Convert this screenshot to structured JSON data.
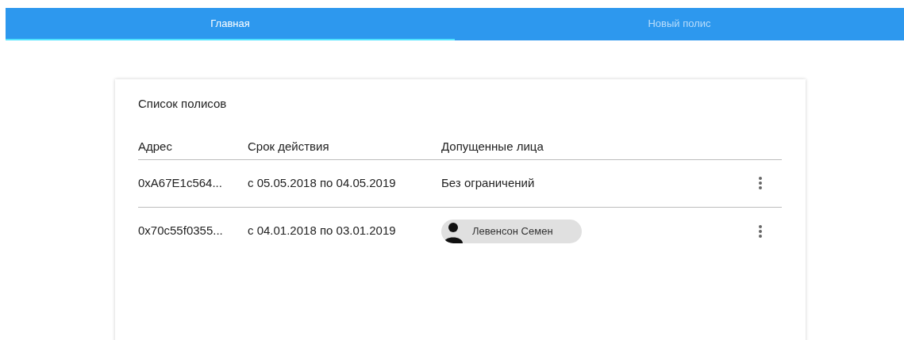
{
  "tabs": [
    {
      "label": "Главная",
      "selected": true
    },
    {
      "label": "Новый полис",
      "selected": false
    }
  ],
  "card": {
    "title": "Список полисов",
    "table": {
      "columns": [
        "Адрес",
        "Срок действия",
        "Допущенные лица"
      ],
      "rows": [
        {
          "address": "0xA67E1c564...",
          "period": "с 05.05.2018 по 04.05.2019",
          "persons": {
            "kind": "text",
            "label": "Без ограничений"
          }
        },
        {
          "address": "0x70c55f0355...",
          "period": "с 04.01.2018 по 03.01.2019",
          "persons": {
            "kind": "chip",
            "label": "Левенсон Семен"
          }
        }
      ]
    }
  }
}
